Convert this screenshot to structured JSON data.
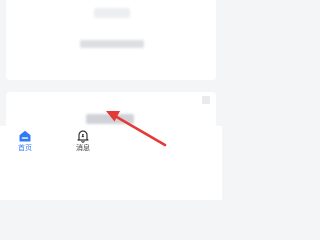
{
  "tabbar": {
    "home_label": "首页",
    "messages_label": "消息"
  },
  "icons": {
    "home": "home-icon",
    "messages": "bell-icon"
  },
  "colors": {
    "accent": "#2f7bf5",
    "annotation": "#e53935",
    "card": "#ffffff",
    "background": "#f4f5f7"
  }
}
